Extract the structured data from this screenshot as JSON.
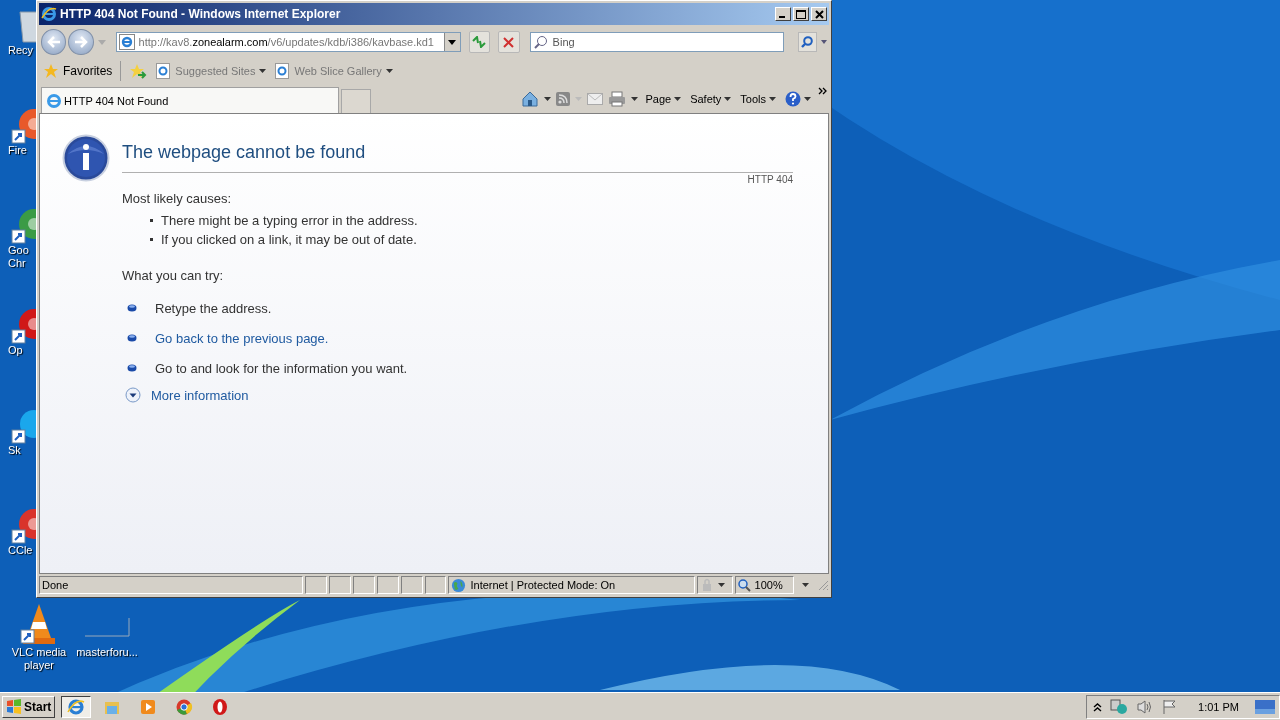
{
  "desktop_icons": [
    {
      "kind": "recycle",
      "lines": [
        "Recy"
      ]
    },
    {
      "kind": "firefox",
      "lines": [
        "Fire"
      ]
    },
    {
      "kind": "chrome",
      "lines": [
        "Goo",
        "Chr"
      ]
    },
    {
      "kind": "opera",
      "lines": [
        "Op"
      ]
    },
    {
      "kind": "skype",
      "lines": [
        "Sk"
      ]
    },
    {
      "kind": "ccleaner",
      "lines": [
        "CCle"
      ]
    }
  ],
  "bottom_icons": [
    {
      "kind": "vlc",
      "lines": [
        "VLC media",
        "player"
      ]
    },
    {
      "kind": "blank",
      "lines": [
        "masterforu..."
      ]
    }
  ],
  "window": {
    "title": "HTTP 404 Not Found - Windows Internet Explorer",
    "address": {
      "prefix": "http://kav8.",
      "domain": "zonealarm.com",
      "path": "/v6/updates/kdb/i386/kavbase.kd1"
    },
    "search": {
      "placeholder": "Bing"
    },
    "favorites": [
      {
        "kind": "favorites",
        "label": "Favorites"
      },
      {
        "kind": "site",
        "label": "Suggested Sites"
      },
      {
        "kind": "site",
        "label": "Web Slice Gallery"
      }
    ],
    "tabs": [
      {
        "label": "HTTP 404 Not Found",
        "selected": true
      }
    ],
    "commands": [
      "Page",
      "Safety",
      "Tools"
    ],
    "page": {
      "title": "The webpage cannot be found",
      "code": "HTTP 404",
      "causes_heading": "Most likely causes:",
      "causes": [
        "There might be a typing error in the address.",
        "If you clicked on a link, it may be out of date."
      ],
      "try_heading": "What you can try:",
      "tries": [
        {
          "kind": "text",
          "text": "Retype the address."
        },
        {
          "kind": "link",
          "text": "Go back to the previous page."
        },
        {
          "kind": "text",
          "text": "Go to  and look for the information you want."
        }
      ],
      "more": "More information"
    },
    "status": {
      "text": "Done",
      "zone": "Internet | Protected Mode: On",
      "zoom": "100%"
    }
  },
  "taskbar": {
    "start": "Start",
    "apps": [
      {
        "kind": "ie",
        "selected": true
      },
      {
        "kind": "explorer",
        "selected": false
      },
      {
        "kind": "media",
        "selected": false
      },
      {
        "kind": "chrome",
        "selected": false
      },
      {
        "kind": "opera",
        "selected": false
      }
    ],
    "clock": "1:01 PM"
  }
}
